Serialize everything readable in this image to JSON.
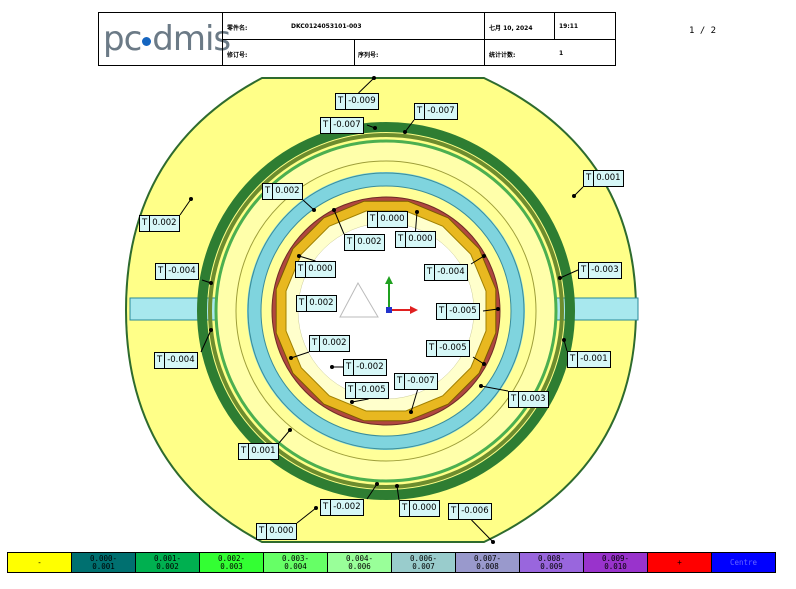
{
  "header": {
    "logo": "pcdmis",
    "part_label": "零件名:",
    "part_value": "DKC0124053101-003",
    "date": "七月 10, 2024",
    "time": "19:11",
    "rev_label": "修订号:",
    "serial_label": "序列号:",
    "stat_label": "统计计数:",
    "stat_value": "1"
  },
  "page_num": "1 / 2",
  "tags": [
    {
      "t": "T",
      "v": "-0.009"
    },
    {
      "t": "T",
      "v": "-0.007"
    },
    {
      "t": "T",
      "v": "-0.007"
    },
    {
      "t": "T",
      "v": "0.001"
    },
    {
      "t": "T",
      "v": "0.002"
    },
    {
      "t": "T",
      "v": "0.000"
    },
    {
      "t": "T",
      "v": "0.000"
    },
    {
      "t": "T",
      "v": "0.002"
    },
    {
      "t": "T",
      "v": "0.000"
    },
    {
      "t": "T",
      "v": "-0.004"
    },
    {
      "t": "T",
      "v": "0.002"
    },
    {
      "t": "T",
      "v": "-0.005"
    },
    {
      "t": "T",
      "v": "-0.003"
    },
    {
      "t": "T",
      "v": "0.002"
    },
    {
      "t": "T",
      "v": "-0.005"
    },
    {
      "t": "T",
      "v": "0.002"
    },
    {
      "t": "T",
      "v": "-0.004"
    },
    {
      "t": "T",
      "v": "-0.004"
    },
    {
      "t": "T",
      "v": "-0.002"
    },
    {
      "t": "T",
      "v": "-0.001"
    },
    {
      "t": "T",
      "v": "-0.005"
    },
    {
      "t": "T",
      "v": "-0.007"
    },
    {
      "t": "T",
      "v": "0.003"
    },
    {
      "t": "T",
      "v": "0.001"
    },
    {
      "t": "T",
      "v": "-0.002"
    },
    {
      "t": "T",
      "v": "0.000"
    },
    {
      "t": "T",
      "v": "-0.006"
    },
    {
      "t": "T",
      "v": "0.000"
    }
  ],
  "legend": [
    {
      "label": "-",
      "color": "#ffff00",
      "text": "#000000"
    },
    {
      "label": "0.000-\n0.001",
      "color": "#007070",
      "text": "#000000"
    },
    {
      "label": "0.001-\n0.002",
      "color": "#00b050",
      "text": "#000000"
    },
    {
      "label": "0.002-\n0.003",
      "color": "#33ff33",
      "text": "#000000"
    },
    {
      "label": "0.003-\n0.004",
      "color": "#66ff66",
      "text": "#000000"
    },
    {
      "label": "0.004-\n0.006",
      "color": "#99ff99",
      "text": "#000000"
    },
    {
      "label": "0.006-\n0.007",
      "color": "#99cccc",
      "text": "#000000"
    },
    {
      "label": "0.007-\n0.008",
      "color": "#9999cc",
      "text": "#000000"
    },
    {
      "label": "0.008-\n0.009",
      "color": "#9966dd",
      "text": "#000000"
    },
    {
      "label": "0.009-\n0.010",
      "color": "#9933cc",
      "text": "#000000"
    },
    {
      "label": "+",
      "color": "#ff0000",
      "text": "#000000"
    },
    {
      "label": "Centre",
      "color": "#0000ff",
      "text": "#6666ff"
    }
  ]
}
